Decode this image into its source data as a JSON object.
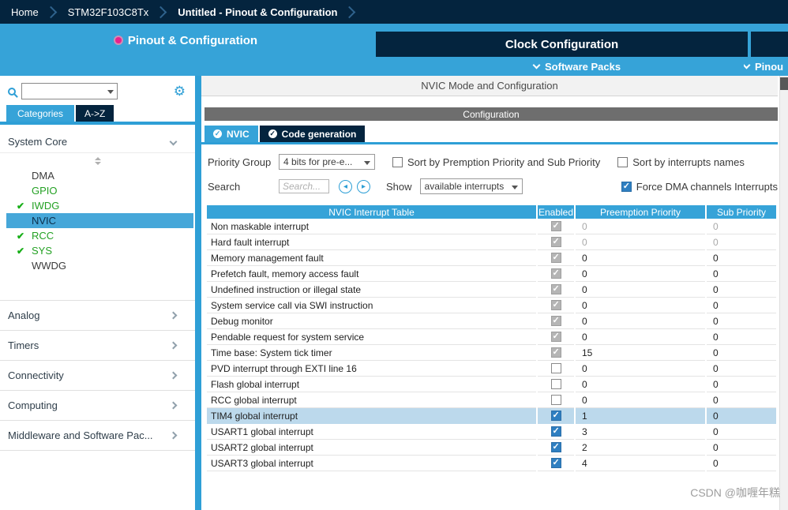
{
  "breadcrumb": {
    "items": [
      {
        "label": "Home"
      },
      {
        "label": "STM32F103C8Tx"
      },
      {
        "label": "Untitled - Pinout & Configuration"
      }
    ]
  },
  "main_tabs": {
    "pinout_label": "Pinout & Configuration",
    "clock_label": "Clock Configuration"
  },
  "sub_tabs": {
    "software_packs_label": "Software Packs",
    "pinout_label": "Pinou"
  },
  "sidebar": {
    "tabs": {
      "categories_label": "Categories",
      "az_label": "A->Z"
    },
    "system_core": {
      "label": "System Core",
      "items": [
        {
          "label": "DMA",
          "state": "plain"
        },
        {
          "label": "GPIO",
          "state": "green"
        },
        {
          "label": "IWDG",
          "state": "checked"
        },
        {
          "label": "NVIC",
          "state": "selected"
        },
        {
          "label": "RCC",
          "state": "checked"
        },
        {
          "label": "SYS",
          "state": "checked"
        },
        {
          "label": "WWDG",
          "state": "plain"
        }
      ]
    },
    "sections": [
      {
        "label": "Analog"
      },
      {
        "label": "Timers"
      },
      {
        "label": "Connectivity"
      },
      {
        "label": "Computing"
      },
      {
        "label": "Middleware and Software Pac..."
      }
    ]
  },
  "panel": {
    "mode_title": "NVIC Mode and Configuration",
    "config_title": "Configuration",
    "tabs": [
      {
        "label": "NVIC",
        "active": true
      },
      {
        "label": "Code generation",
        "active": false
      }
    ],
    "controls": {
      "priority_group_label": "Priority Group",
      "priority_group_value": "4 bits for pre-e...",
      "sort_premption_label": "Sort by Premption Priority and Sub Priority",
      "sort_names_label": "Sort by interrupts names",
      "search_label": "Search",
      "search_placeholder": "Search...",
      "show_label": "Show",
      "show_value": "available interrupts",
      "force_dma_label": "Force DMA channels Interrupts"
    },
    "table": {
      "headers": [
        "NVIC Interrupt Table",
        "Enabled",
        "Preemption Priority",
        "Sub Priority"
      ],
      "rows": [
        {
          "name": "Non maskable interrupt",
          "enabled": "checked_disabled",
          "preemption": "0",
          "sub": "0",
          "dim": true,
          "highlighted": false
        },
        {
          "name": "Hard fault interrupt",
          "enabled": "checked_disabled",
          "preemption": "0",
          "sub": "0",
          "dim": true,
          "highlighted": false
        },
        {
          "name": "Memory management fault",
          "enabled": "checked_disabled",
          "preemption": "0",
          "sub": "0",
          "dim": false,
          "highlighted": false
        },
        {
          "name": "Prefetch fault, memory access fault",
          "enabled": "checked_disabled",
          "preemption": "0",
          "sub": "0",
          "dim": false,
          "highlighted": false
        },
        {
          "name": "Undefined instruction or illegal state",
          "enabled": "checked_disabled",
          "preemption": "0",
          "sub": "0",
          "dim": false,
          "highlighted": false
        },
        {
          "name": "System service call via SWI instruction",
          "enabled": "checked_disabled",
          "preemption": "0",
          "sub": "0",
          "dim": false,
          "highlighted": false
        },
        {
          "name": "Debug monitor",
          "enabled": "checked_disabled",
          "preemption": "0",
          "sub": "0",
          "dim": false,
          "highlighted": false
        },
        {
          "name": "Pendable request for system service",
          "enabled": "checked_disabled",
          "preemption": "0",
          "sub": "0",
          "dim": false,
          "highlighted": false
        },
        {
          "name": "Time base: System tick timer",
          "enabled": "checked_disabled",
          "preemption": "15",
          "sub": "0",
          "dim": false,
          "highlighted": false
        },
        {
          "name": "PVD interrupt through EXTI line 16",
          "enabled": "unchecked",
          "preemption": "0",
          "sub": "0",
          "dim": false,
          "highlighted": false
        },
        {
          "name": "Flash global interrupt",
          "enabled": "unchecked",
          "preemption": "0",
          "sub": "0",
          "dim": false,
          "highlighted": false
        },
        {
          "name": "RCC global interrupt",
          "enabled": "unchecked",
          "preemption": "0",
          "sub": "0",
          "dim": false,
          "highlighted": false
        },
        {
          "name": "TIM4 global interrupt",
          "enabled": "checked",
          "preemption": "1",
          "sub": "0",
          "dim": false,
          "highlighted": true
        },
        {
          "name": "USART1 global interrupt",
          "enabled": "checked",
          "preemption": "3",
          "sub": "0",
          "dim": false,
          "highlighted": false
        },
        {
          "name": "USART2 global interrupt",
          "enabled": "checked",
          "preemption": "2",
          "sub": "0",
          "dim": false,
          "highlighted": false
        },
        {
          "name": "USART3 global interrupt",
          "enabled": "checked",
          "preemption": "4",
          "sub": "0",
          "dim": false,
          "highlighted": false
        }
      ]
    }
  },
  "icons": {
    "check": "✔",
    "gear": "⚙"
  },
  "watermark": "CSDN @咖喱年糕",
  "colors": {
    "accent_blue": "#36a3d8",
    "navy": "#04243e",
    "green": "#24a124",
    "pink_dot": "#e9218c",
    "highlight_row": "#bcd9ec",
    "config_gray": "#6e6e6e",
    "checkbox_blue": "#2f7fc1"
  }
}
